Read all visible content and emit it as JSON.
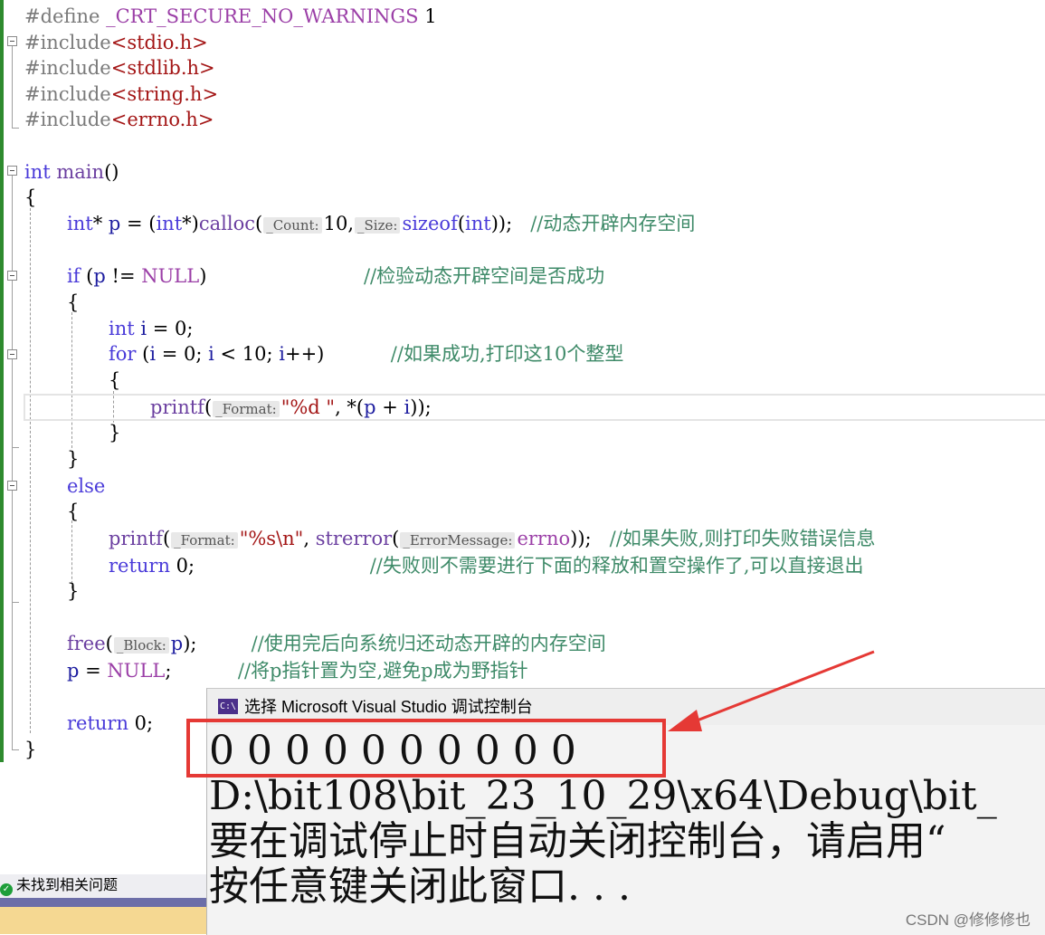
{
  "editor": {
    "lines": [
      {
        "id": "l1",
        "tokens": [
          {
            "c": "pp",
            "t": "#define "
          },
          {
            "c": "mac",
            "t": "_CRT_SECURE_NO_WARNINGS"
          },
          {
            "c": "",
            "t": " 1"
          }
        ]
      },
      {
        "id": "l2",
        "tokens": [
          {
            "c": "pp",
            "t": "#include"
          },
          {
            "c": "inc",
            "t": "<stdio.h>"
          }
        ]
      },
      {
        "id": "l3",
        "tokens": [
          {
            "c": "pp",
            "t": "#include"
          },
          {
            "c": "inc",
            "t": "<stdlib.h>"
          }
        ]
      },
      {
        "id": "l4",
        "tokens": [
          {
            "c": "pp",
            "t": "#include"
          },
          {
            "c": "inc",
            "t": "<string.h>"
          }
        ]
      },
      {
        "id": "l5",
        "tokens": [
          {
            "c": "pp",
            "t": "#include"
          },
          {
            "c": "inc",
            "t": "<errno.h>"
          }
        ]
      },
      {
        "id": "l6",
        "tokens": []
      },
      {
        "id": "l7",
        "tokens": [
          {
            "c": "kw",
            "t": "int"
          },
          {
            "c": "",
            "t": " "
          },
          {
            "c": "fn",
            "t": "main"
          },
          {
            "c": "",
            "t": "()"
          }
        ]
      },
      {
        "id": "l8",
        "tokens": [
          {
            "c": "",
            "t": "{"
          }
        ]
      },
      {
        "id": "l9",
        "tokens": [
          {
            "c": "kw",
            "t": "int"
          },
          {
            "c": "",
            "t": "* "
          },
          {
            "c": "var",
            "t": "p"
          },
          {
            "c": "",
            "t": " = ("
          },
          {
            "c": "kw",
            "t": "int"
          },
          {
            "c": "",
            "t": "*)"
          },
          {
            "c": "fn",
            "t": "calloc"
          },
          {
            "c": "",
            "t": "("
          },
          {
            "c": "hint",
            "t": "_Count:"
          },
          {
            "c": "",
            "t": "10,"
          },
          {
            "c": "hint",
            "t": "_Size:"
          },
          {
            "c": "kw",
            "t": "sizeof"
          },
          {
            "c": "",
            "t": "("
          },
          {
            "c": "kw",
            "t": "int"
          },
          {
            "c": "",
            "t": "));   "
          },
          {
            "c": "cm",
            "t": "//动态开辟内存空间"
          }
        ]
      },
      {
        "id": "l10",
        "tokens": []
      },
      {
        "id": "l11",
        "tokens": [
          {
            "c": "kw",
            "t": "if"
          },
          {
            "c": "",
            "t": " ("
          },
          {
            "c": "var",
            "t": "p"
          },
          {
            "c": "",
            "t": " != "
          },
          {
            "c": "mac",
            "t": "NULL"
          },
          {
            "c": "",
            "t": ")                          "
          },
          {
            "c": "cm",
            "t": "//检验动态开辟空间是否成功"
          }
        ]
      },
      {
        "id": "l12",
        "tokens": [
          {
            "c": "",
            "t": "{"
          }
        ]
      },
      {
        "id": "l13",
        "tokens": [
          {
            "c": "kw",
            "t": "int"
          },
          {
            "c": "",
            "t": " "
          },
          {
            "c": "var",
            "t": "i"
          },
          {
            "c": "",
            "t": " = 0;"
          }
        ]
      },
      {
        "id": "l14",
        "tokens": [
          {
            "c": "kw",
            "t": "for"
          },
          {
            "c": "",
            "t": " ("
          },
          {
            "c": "var",
            "t": "i"
          },
          {
            "c": "",
            "t": " = 0; "
          },
          {
            "c": "var",
            "t": "i"
          },
          {
            "c": "",
            "t": " < 10; "
          },
          {
            "c": "var",
            "t": "i"
          },
          {
            "c": "",
            "t": "++)           "
          },
          {
            "c": "cm",
            "t": "//如果成功,打印这10个整型"
          }
        ]
      },
      {
        "id": "l15",
        "tokens": [
          {
            "c": "",
            "t": "{"
          }
        ]
      },
      {
        "id": "l16",
        "tokens": [
          {
            "c": "fn",
            "t": "printf"
          },
          {
            "c": "",
            "t": "("
          },
          {
            "c": "hint",
            "t": "_Format:"
          },
          {
            "c": "str",
            "t": "\"%d \""
          },
          {
            "c": "",
            "t": ", *("
          },
          {
            "c": "var",
            "t": "p"
          },
          {
            "c": "",
            "t": " + "
          },
          {
            "c": "var",
            "t": "i"
          },
          {
            "c": "",
            "t": "));"
          }
        ]
      },
      {
        "id": "l17",
        "tokens": [
          {
            "c": "",
            "t": "}"
          }
        ]
      },
      {
        "id": "l18",
        "tokens": [
          {
            "c": "",
            "t": "}"
          }
        ]
      },
      {
        "id": "l19",
        "tokens": [
          {
            "c": "kw",
            "t": "else"
          }
        ]
      },
      {
        "id": "l20",
        "tokens": [
          {
            "c": "",
            "t": "{"
          }
        ]
      },
      {
        "id": "l21",
        "tokens": [
          {
            "c": "fn",
            "t": "printf"
          },
          {
            "c": "",
            "t": "("
          },
          {
            "c": "hint",
            "t": "_Format:"
          },
          {
            "c": "str",
            "t": "\"%s\\n\""
          },
          {
            "c": "",
            "t": ", "
          },
          {
            "c": "fn",
            "t": "strerror"
          },
          {
            "c": "",
            "t": "("
          },
          {
            "c": "hint",
            "t": "_ErrorMessage:"
          },
          {
            "c": "mac",
            "t": "errno"
          },
          {
            "c": "",
            "t": "));   "
          },
          {
            "c": "cm",
            "t": "//如果失败,则打印失败错误信息"
          }
        ]
      },
      {
        "id": "l22",
        "tokens": [
          {
            "c": "kw",
            "t": "return"
          },
          {
            "c": "",
            "t": " 0;                             "
          },
          {
            "c": "cm",
            "t": "//失败则不需要进行下面的释放和置空操作了,可以直接退出"
          }
        ]
      },
      {
        "id": "l23",
        "tokens": [
          {
            "c": "",
            "t": "}"
          }
        ]
      },
      {
        "id": "l24",
        "tokens": []
      },
      {
        "id": "l25",
        "tokens": [
          {
            "c": "fn",
            "t": "free"
          },
          {
            "c": "",
            "t": "("
          },
          {
            "c": "hint",
            "t": "_Block:"
          },
          {
            "c": "var",
            "t": "p"
          },
          {
            "c": "",
            "t": ");         "
          },
          {
            "c": "cm",
            "t": "//使用完后向系统归还动态开辟的内存空间"
          }
        ]
      },
      {
        "id": "l26",
        "tokens": [
          {
            "c": "var",
            "t": "p"
          },
          {
            "c": "",
            "t": " = "
          },
          {
            "c": "mac",
            "t": "NULL"
          },
          {
            "c": "",
            "t": ";           "
          },
          {
            "c": "cm",
            "t": "//将p指针置为空,避免p成为野指针"
          }
        ]
      },
      {
        "id": "l27",
        "tokens": []
      },
      {
        "id": "l28",
        "tokens": [
          {
            "c": "kw",
            "t": "return"
          },
          {
            "c": "",
            "t": " 0;"
          }
        ]
      },
      {
        "id": "l29",
        "tokens": [
          {
            "c": "",
            "t": "}"
          }
        ]
      }
    ]
  },
  "status": {
    "ok_glyph": "✓",
    "message": "未找到相关问题"
  },
  "console": {
    "icon_text": "C:\\",
    "title": "选择 Microsoft Visual Studio 调试控制台",
    "output_line": "0 0 0 0 0 0 0 0 0 0",
    "path_line": "D:\\bit108\\bit_23_10_29\\x64\\Debug\\bit_",
    "hint_line": "要在调试停止时自动关闭控制台，请启用“",
    "close_line": "按任意键关闭此窗口. . ."
  },
  "watermark": "CSDN @修修修也",
  "colors": {
    "keyword": "#4a3bd9",
    "comment": "#3e8a68",
    "highlight_box": "#e53935",
    "console_bg": "#f3f3f3"
  }
}
